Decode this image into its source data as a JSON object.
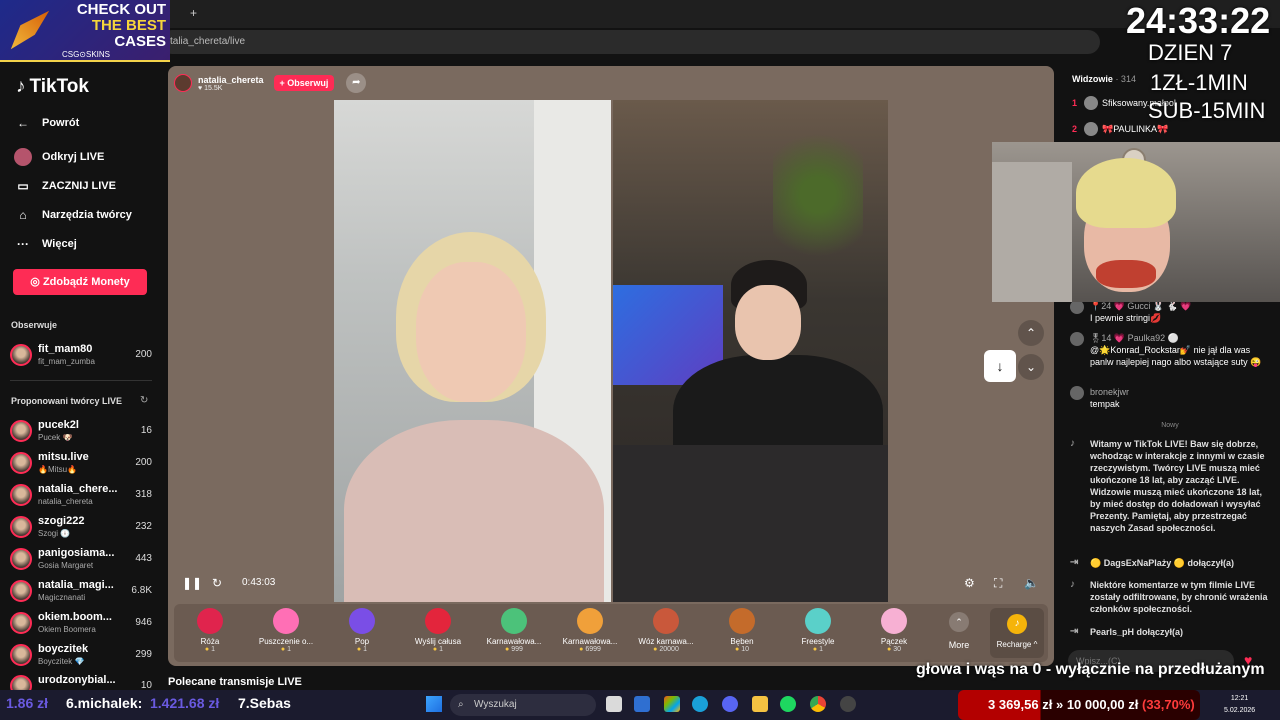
{
  "promo": {
    "line1": "CHECK OUT",
    "line2": "THE BEST",
    "line3": "CASES",
    "brand": "CSG⊙SKINS"
  },
  "browser": {
    "url": "talia_chereta/live",
    "new_tab": "+"
  },
  "sidebar": {
    "logo": "TikTok",
    "back": "Powrót",
    "nav": [
      {
        "label": "Odkryj LIVE",
        "icon": "live-icon"
      },
      {
        "label": "ZACZNIJ LIVE",
        "icon": "camera-icon"
      },
      {
        "label": "Narzędzia twórcy",
        "icon": "home-icon"
      },
      {
        "label": "Więcej",
        "icon": "more-icon"
      }
    ],
    "coins_button": "Zdobądź Monety",
    "following_heading": "Obserwuje",
    "following": [
      {
        "name": "fit_mam80",
        "sub": "fit_mam_zumba",
        "count": "200"
      }
    ],
    "suggested_heading": "Proponowani twórcy LIVE",
    "suggested": [
      {
        "name": "pucek2l",
        "sub": "Pucek 🐶",
        "count": "16"
      },
      {
        "name": "mitsu.live",
        "sub": "🔥Mitsu🔥",
        "count": "200"
      },
      {
        "name": "natalia_chere...",
        "sub": "natalia_chereta",
        "count": "318"
      },
      {
        "name": "szogi222",
        "sub": "Szogi 🕕",
        "count": "232"
      },
      {
        "name": "panigosiama...",
        "sub": "Gosia Margaret",
        "count": "443"
      },
      {
        "name": "natalia_magi...",
        "sub": "Magicznanati",
        "count": "6.8K"
      },
      {
        "name": "okiem.boom...",
        "sub": "Okiem Boomera",
        "count": "946"
      },
      {
        "name": "boyczitek",
        "sub": "Boyczitek 💎",
        "count": "299"
      },
      {
        "name": "urodzonybial...",
        "sub": "",
        "count": "10"
      }
    ]
  },
  "player": {
    "host_name": "natalia_chereta",
    "host_likes": "♥ 15.5K",
    "follow_label": "+ Obserwuj",
    "time": "0:43:03",
    "gifts": [
      {
        "name": "Róża",
        "price": "1",
        "color": "#e0244d"
      },
      {
        "name": "Puszczenie o...",
        "price": "1",
        "color": "#ff6fb5"
      },
      {
        "name": "Pop",
        "price": "1",
        "color": "#7a4ee6"
      },
      {
        "name": "Wyślij całusa",
        "price": "1",
        "color": "#e3253c"
      },
      {
        "name": "Karnawałowa...",
        "price": "999",
        "color": "#4cc27a"
      },
      {
        "name": "Karnawałowa...",
        "price": "6999",
        "color": "#f0a03a"
      },
      {
        "name": "Wóz karnawa...",
        "price": "20000",
        "color": "#c9583b"
      },
      {
        "name": "Bęben",
        "price": "10",
        "color": "#c46b2b"
      },
      {
        "name": "Freestyle",
        "price": "1",
        "color": "#5ad0c9"
      },
      {
        "name": "Pączek",
        "price": "30",
        "color": "#f7b0d3"
      }
    ],
    "more_label": "More",
    "recharge_label": "Recharge ^"
  },
  "recommended_heading": "Polecane transmisje LIVE",
  "chat": {
    "viewers_label": "Widzowie",
    "viewers_count": "· 314",
    "top_viewers": [
      {
        "rank": "1",
        "name": "Sfiksowany.małpol"
      },
      {
        "rank": "2",
        "name": "🎀PAULINKA🎀"
      }
    ],
    "messages": [
      {
        "user": "📍24 💗 Gucci 🐰 🐇 💗",
        "text": "I pewnie stringi💋"
      },
      {
        "user": "🎖14 💗 Paulka92 ⚪",
        "text": "@🌟Konrad_Rockstar💅 nie jął dla was panlw najlepiej nago albo wstające suty 😜"
      },
      {
        "user": "bronekjwr",
        "text": "tempak"
      }
    ],
    "new_divider": "Nowy",
    "system_messages": [
      {
        "text": "Witamy w TikTok LIVE! Baw się dobrze, wchodząc w interakcje z innymi w czasie rzeczywistym. Twórcy LIVE muszą mieć ukończone 18 lat, aby zacząć LIVE. Widzowie muszą mieć ukończone 18 lat, by mieć dostęp do doładowań i wysyłać Prezenty. Pamiętaj, aby przestrzegać naszych Zasad społeczności."
      },
      {
        "text": "🟡 DagsExNaPlaży 🟡 dołączył(a)"
      },
      {
        "text": "Niektóre komentarze w tym filmie LIVE zostały odfiltrowane, by chronić wrażenia członków społeczności."
      },
      {
        "text": "Pearls_pH  dołączył(a)"
      }
    ],
    "input_placeholder": "Wpisz...(C)"
  },
  "overlay": {
    "timer": "24:33:22",
    "day": "DZIEN 7",
    "rate1": "1ZŁ-1MIN",
    "rate2": "SUB-15MIN",
    "banner": "głowa i wąs na 0 - wyłącznie na przedłużanym"
  },
  "taskbar": {
    "don1_amount": "1.86 zł",
    "don2_name": "6.michalek:",
    "don2_amount": "1.421.68 zł",
    "don3_name": "7.Sebas",
    "search_label": "Wyszukaj",
    "goal_current": "3 369,56 zł",
    "goal_separator": "»",
    "goal_target": "10 000,00 zł",
    "goal_pct": "(33,70%)",
    "clock_time": "12:21",
    "clock_date": "5.02.2026"
  }
}
